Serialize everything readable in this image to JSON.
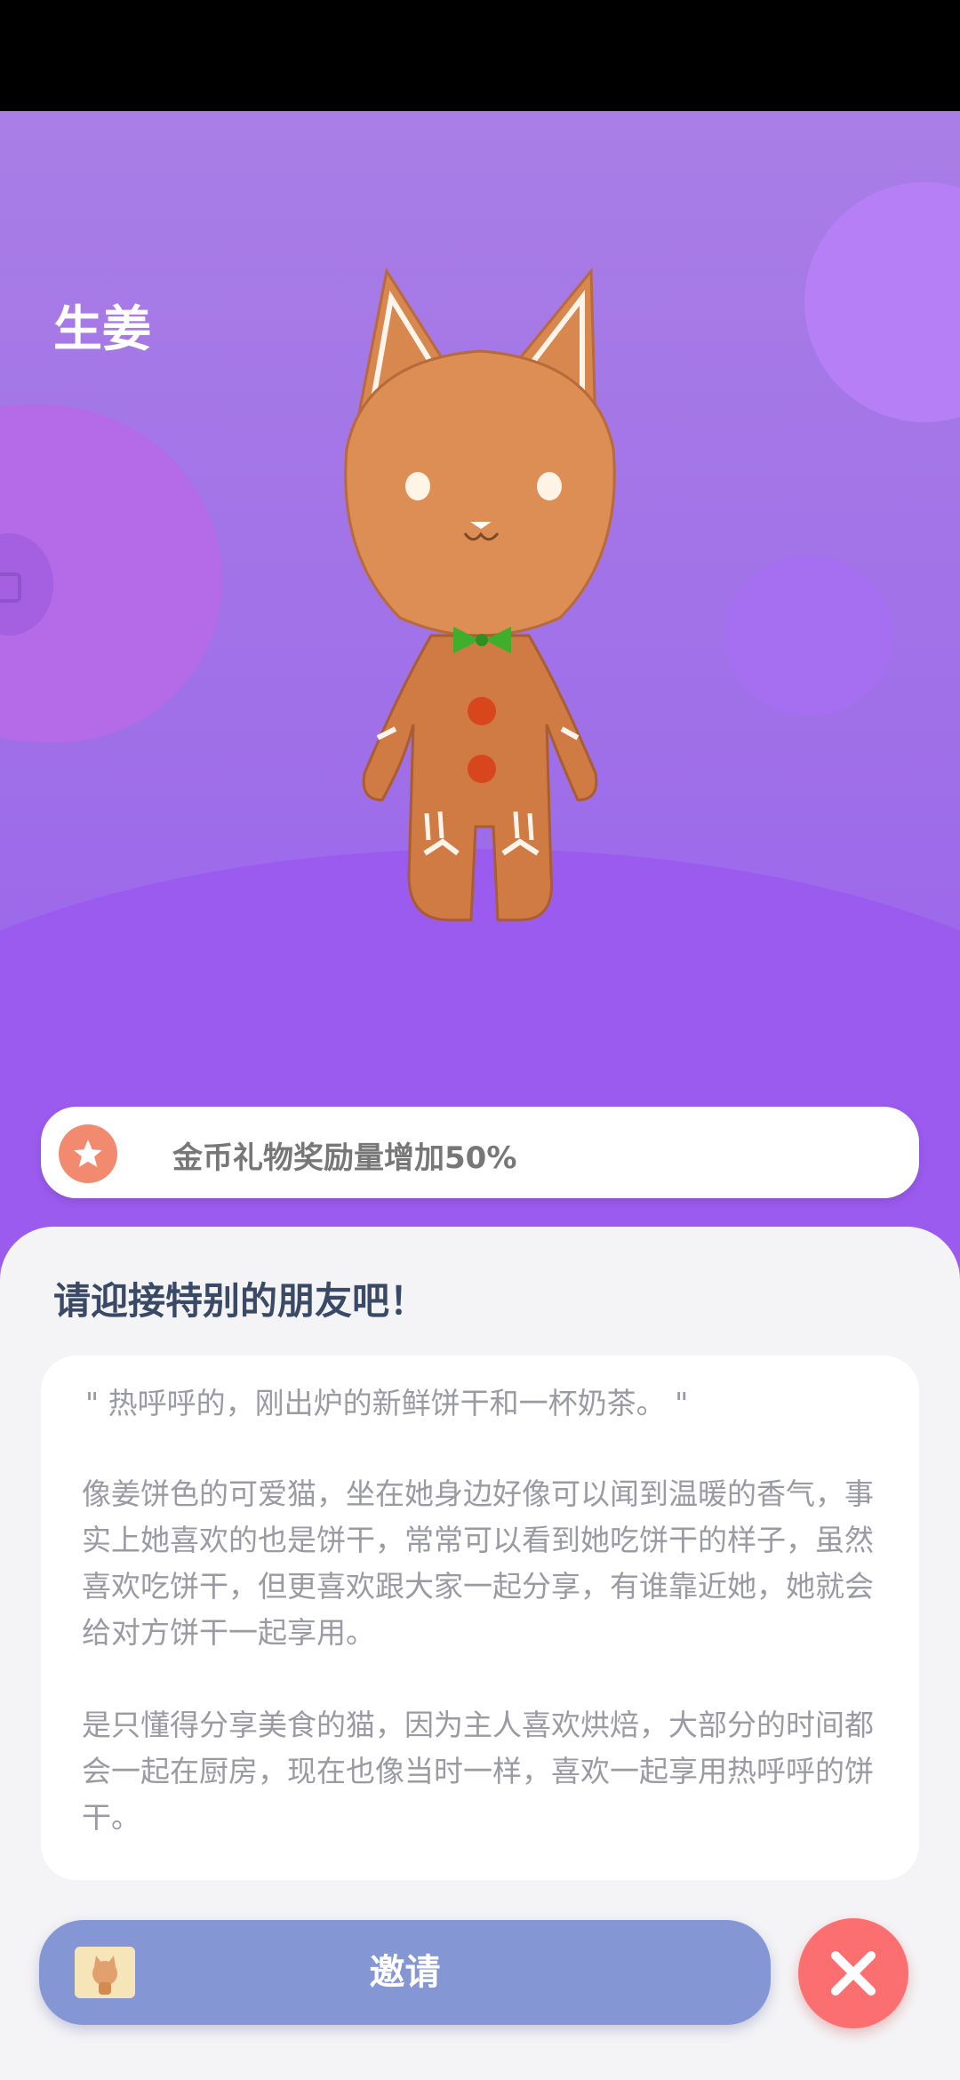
{
  "pet": {
    "name": "生姜"
  },
  "bonus": {
    "text": "金币礼物奖励量增加50%"
  },
  "panel": {
    "title": "请迎接特别的朋友吧！",
    "quote": "\" 热呼呼的，刚出炉的新鲜饼干和一杯奶茶。 \"",
    "paragraph1": "像姜饼色的可爱猫，坐在她身边好像可以闻到温暖的香气，事实上她喜欢的也是饼干，常常可以看到她吃饼干的样子，虽然喜欢吃饼干，但更喜欢跟大家一起分享，有谁靠近她，她就会给对方饼干一起享用。",
    "paragraph2": "是只懂得分享美食的猫，因为主人喜欢烘焙，大部分的时间都会一起在厨房，现在也像当时一样，喜欢一起享用热呼呼的饼干。"
  },
  "actions": {
    "invite_label": "邀请"
  },
  "icons": {
    "bonus": "star-icon",
    "close": "close-icon",
    "invite": "ticket-icon"
  },
  "colors": {
    "accent_purple": "#9f6fe8",
    "invite_button": "#8496d4",
    "close_button": "#fb6f70",
    "bonus_icon": "#f28a70"
  }
}
